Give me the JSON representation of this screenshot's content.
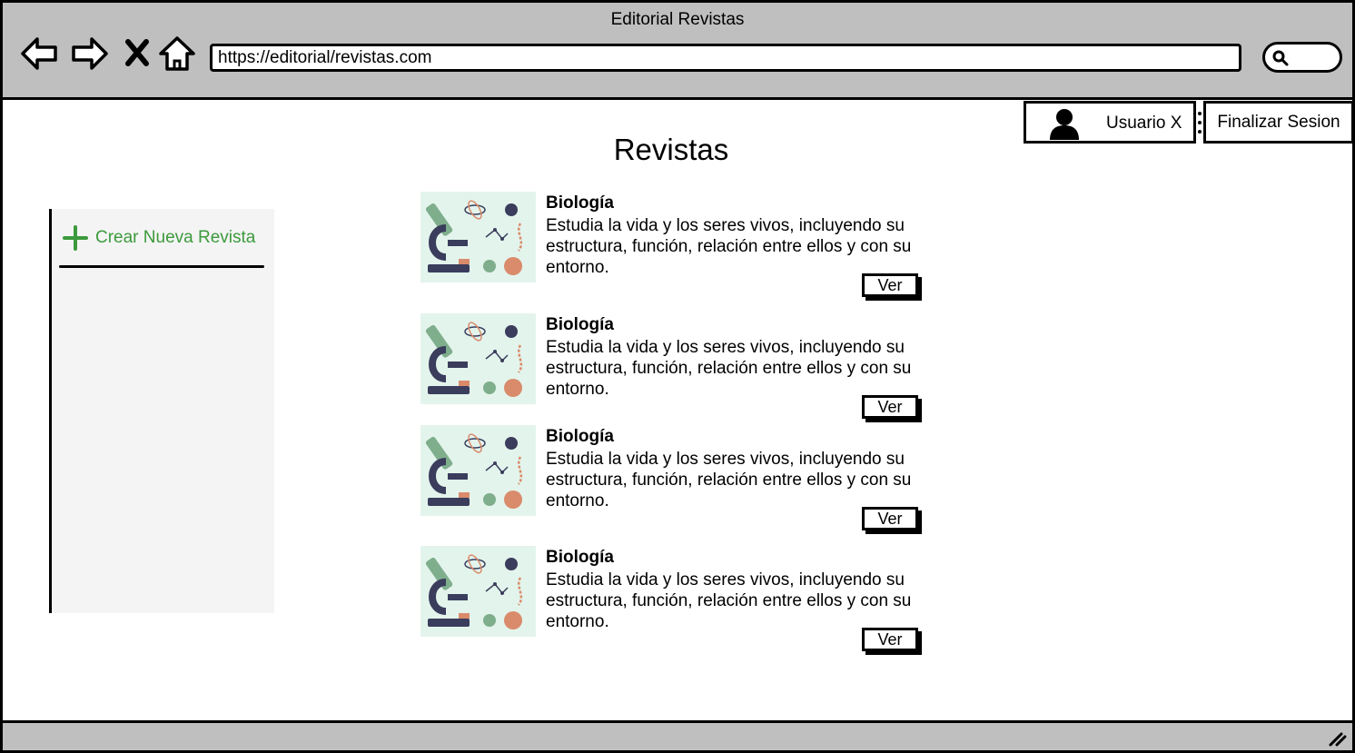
{
  "window": {
    "title": "Editorial Revistas"
  },
  "browser": {
    "url": "https://editorial/revistas.com",
    "icons": [
      "back-arrow-icon",
      "forward-arrow-icon",
      "close-icon",
      "home-icon",
      "search-icon"
    ]
  },
  "user": {
    "name": "Usuario X",
    "logout_label": "Finalizar Sesion"
  },
  "page": {
    "title": "Revistas"
  },
  "sidebar": {
    "create_label": "Crear Nueva Revista",
    "accent": "#3c9a3c"
  },
  "magazines": [
    {
      "title": "Biología",
      "description": "Estudia la vida y los seres vivos, incluyendo su estructura, función, relación entre ellos y con su entorno.",
      "button": "Ver"
    },
    {
      "title": "Biología",
      "description": "Estudia la vida y los seres vivos, incluyendo su estructura, función, relación entre ellos y con su entorno.",
      "button": "Ver"
    },
    {
      "title": "Biología",
      "description": "Estudia la vida y los seres vivos, incluyendo su estructura, función, relación entre ellos y con su entorno.",
      "button": "Ver"
    },
    {
      "title": "Biología",
      "description": "Estudia la vida y los seres vivos, incluyendo su estructura, función, relación entre ellos y con su entorno.",
      "button": "Ver"
    }
  ]
}
